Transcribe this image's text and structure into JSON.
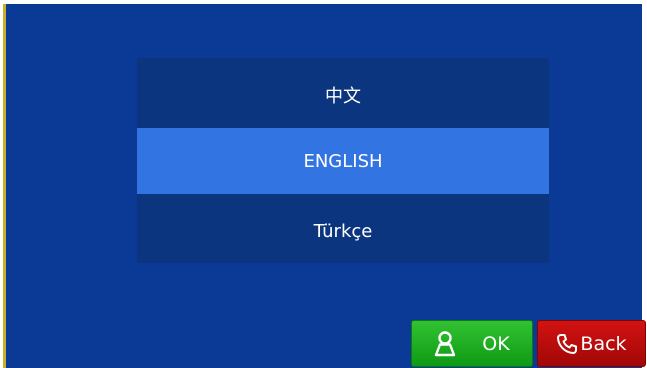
{
  "languages": [
    {
      "label": "中文"
    },
    {
      "label": "ENGLISH",
      "selected": true
    },
    {
      "label": "Türkçe"
    }
  ],
  "buttons": {
    "ok_label": "OK",
    "back_label": "Back"
  },
  "icons": {
    "ok": "person-icon",
    "back": "phone-icon"
  },
  "colors": {
    "background": "#0a3a96",
    "list_background": "#0b367f",
    "selected": "#3174e2",
    "ok_button": "#17a31b",
    "back_button": "#bf0d0d"
  }
}
